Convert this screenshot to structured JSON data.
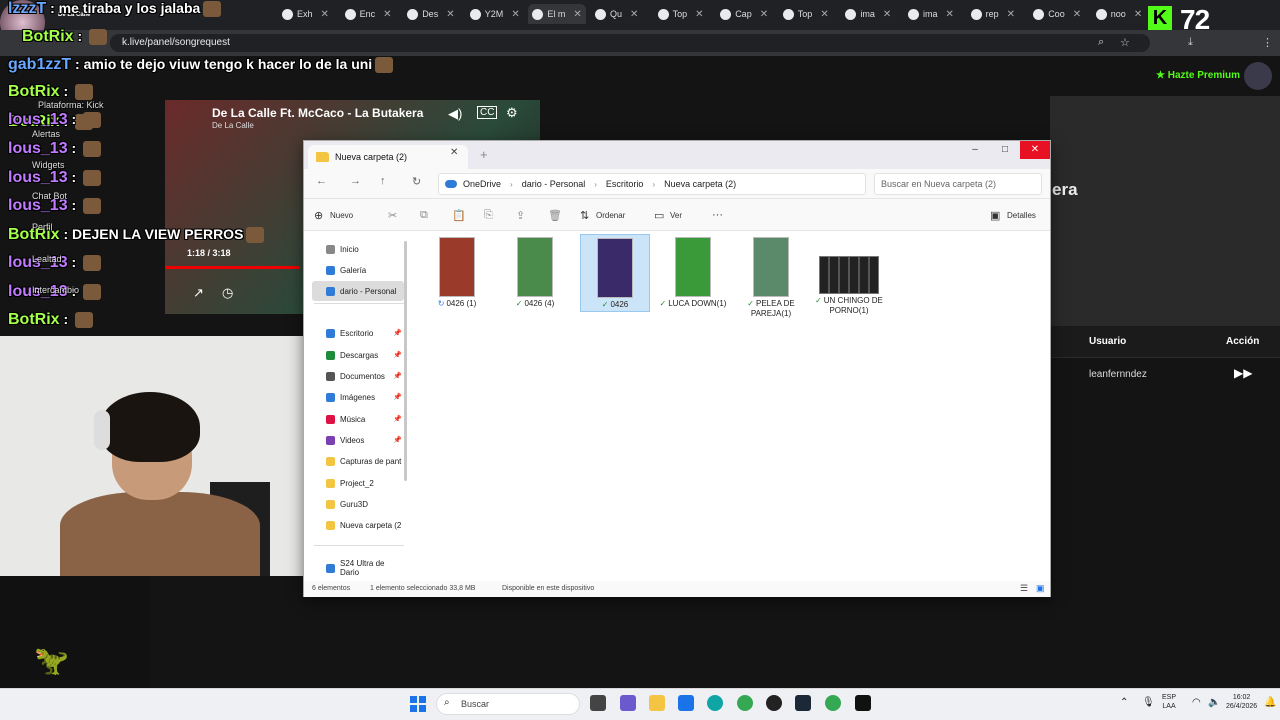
{
  "browser": {
    "tabs": [
      {
        "label": "Exh"
      },
      {
        "label": "Enc"
      },
      {
        "label": "Des"
      },
      {
        "label": "Y2M"
      },
      {
        "label": "El m"
      },
      {
        "label": "Qu"
      },
      {
        "label": "Top"
      },
      {
        "label": "Cap"
      },
      {
        "label": "Top"
      },
      {
        "label": "ima"
      },
      {
        "label": "ima"
      },
      {
        "label": "rep"
      },
      {
        "label": "Coo"
      },
      {
        "label": "noo"
      }
    ],
    "url": "k.live/panel/songrequest",
    "viewer_count": "72",
    "kick_logo": "K"
  },
  "stream_header": {
    "channel": "De La Calle",
    "subtitle": "De La Calle Ft. McCaco - La Butakera"
  },
  "chat": [
    {
      "user": "lzzzT",
      "color": "#6aa7ff",
      "msg": "me tiraba y los jalaba"
    },
    {
      "user": "BotRix",
      "color": "#a4ff4a",
      "msg": ""
    },
    {
      "user": "gab1zzT",
      "color": "#6aa7ff",
      "msg": "amio te dejo viuw tengo k hacer lo de la uni"
    },
    {
      "user": "BotRix",
      "color": "#a4ff4a",
      "msg": ""
    },
    {
      "user": "BotRix",
      "color": "#a4ff4a",
      "msg": ""
    },
    {
      "user": "lous_13",
      "color": "#c07bff",
      "msg": ""
    },
    {
      "user": "lous_13",
      "color": "#c07bff",
      "msg": ""
    },
    {
      "user": "lous_13",
      "color": "#c07bff",
      "msg": ""
    },
    {
      "user": "lous_13",
      "color": "#c07bff",
      "msg": ""
    },
    {
      "user": "BotRix",
      "color": "#a4ff4a",
      "msg": "DEJEN LA VIEW PERROS"
    },
    {
      "user": "lous_13",
      "color": "#c07bff",
      "msg": ""
    },
    {
      "user": "lous_13",
      "color": "#c07bff",
      "msg": ""
    },
    {
      "user": "BotRix",
      "color": "#a4ff4a",
      "msg": ""
    }
  ],
  "chat_small": {
    "plataforma": "Plataforma: Kick",
    "alertas": "Alertas",
    "widgets": "Widgets",
    "chat_bot": "Chat Bot",
    "perfil": "Perfil",
    "lealtad": "Lealtad",
    "intercambio": "Intercambio"
  },
  "player": {
    "title": "De La Calle Ft. McCaco - La Butakera",
    "artist": "De La Calle",
    "time": "1:18 / 3:18"
  },
  "panel": {
    "premium": "Hazte Premium",
    "overlay_text": "era",
    "col_user": "Usuario",
    "col_action": "Acción",
    "row_user": "leanfernndez"
  },
  "explorer": {
    "tab_title": "Nueva carpeta (2)",
    "breadcrumbs": [
      "OneDrive",
      "dario - Personal",
      "Escritorio",
      "Nueva carpeta (2)"
    ],
    "search_placeholder": "Buscar en Nueva carpeta (2)",
    "toolbar": {
      "nuevo": "Nuevo",
      "ordenar": "Ordenar",
      "ver": "Ver",
      "more": "···",
      "detalles": "Detalles"
    },
    "sidebar": [
      {
        "label": "Inicio",
        "color": "#888"
      },
      {
        "label": "Galería",
        "color": "#2f7bd6"
      },
      {
        "label": "dario - Personal",
        "color": "#2f7bd6"
      },
      {
        "label": "Escritorio",
        "color": "#2f7bd6"
      },
      {
        "label": "Descargas",
        "color": "#1e8c3a"
      },
      {
        "label": "Documentos",
        "color": "#555"
      },
      {
        "label": "Imágenes",
        "color": "#2f7bd6"
      },
      {
        "label": "Música",
        "color": "#d14"
      },
      {
        "label": "Videos",
        "color": "#7a3fb0"
      },
      {
        "label": "Capturas de pant",
        "color": "#f4c542"
      },
      {
        "label": "Project_2",
        "color": "#f4c542"
      },
      {
        "label": "Guru3D",
        "color": "#f4c542"
      },
      {
        "label": "Nueva carpeta (2",
        "color": "#f4c542"
      },
      {
        "label": "S24 Ultra de Dario",
        "color": "#2f7bd6"
      }
    ],
    "files": [
      {
        "name": "0426 (1)",
        "status": "↻",
        "thumb": "#9a3a2a"
      },
      {
        "name": "0426 (4)",
        "status": "✓",
        "thumb": "#4a8a4a"
      },
      {
        "name": "0426",
        "status": "✓",
        "thumb": "#3a2a6a"
      },
      {
        "name": "LUCA DOWN(1)",
        "status": "✓",
        "thumb": "#3a9a3a"
      },
      {
        "name": "PELEA DE PAREJA(1)",
        "status": "✓",
        "thumb": "#5a8a6a"
      },
      {
        "name": "UN CHINGO DE PORNO(1)",
        "status": "✓",
        "thumb": "wide"
      }
    ],
    "status": {
      "count": "6 elementos",
      "selected": "1 elemento seleccionado  33,8 MB",
      "availability": "Disponible en este dispositivo"
    }
  },
  "taskbar": {
    "search": "Buscar",
    "lang": "ESP",
    "lang2": "LAA",
    "time": "16:02",
    "date": "26/4/2026"
  }
}
